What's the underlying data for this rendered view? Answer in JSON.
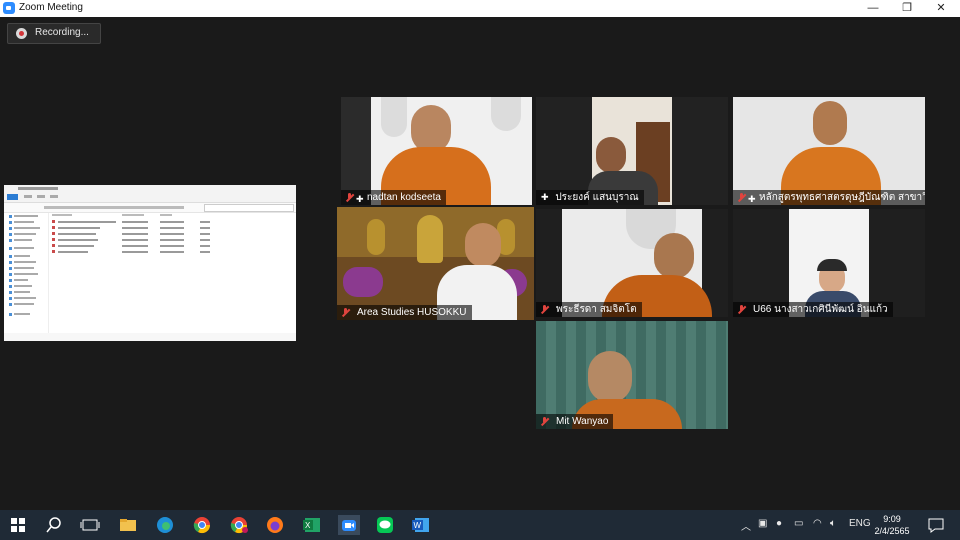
{
  "window": {
    "title": "Zoom Meeting",
    "controls": {
      "minimize": "—",
      "maximize": "❐",
      "close": "✕"
    }
  },
  "recording": {
    "label": "Recording..."
  },
  "participants": [
    {
      "name": "nadtan kodseeta",
      "muted": true,
      "pinned": true
    },
    {
      "name": "ประยงค์ แสนบุราณ",
      "muted": false,
      "pinned": true
    },
    {
      "name": "หลักสูตรพุทธศาสตรดุษฎีบัณฑิต สาขาวิ...",
      "muted": true,
      "pinned": true
    },
    {
      "name": "Area Studies HUSOKKU",
      "muted": true,
      "pinned": false,
      "speaking": true
    },
    {
      "name": "พระธีรดา สมจิตโต",
      "muted": true,
      "pinned": false
    },
    {
      "name": "U66 นางสาวเกศินีพัฒน์ อินแก้ว",
      "muted": true,
      "pinned": false
    },
    {
      "name": "Mit Wanyao",
      "muted": true,
      "pinned": false
    }
  ],
  "taskbar": {
    "apps": [
      "windows-start",
      "search",
      "task-view",
      "file-explorer",
      "edge",
      "chrome",
      "chrome-profile",
      "firefox",
      "excel",
      "zoom",
      "line",
      "word"
    ],
    "tray": {
      "language": "ENG"
    },
    "clock": {
      "time": "9:09",
      "date": "2/4/2565"
    }
  },
  "colors": {
    "speaking_border": "#c7ff1f",
    "mic_muted": "#e0443e",
    "zoom_blue": "#2d8cff",
    "taskbar": "#1f2a36"
  }
}
